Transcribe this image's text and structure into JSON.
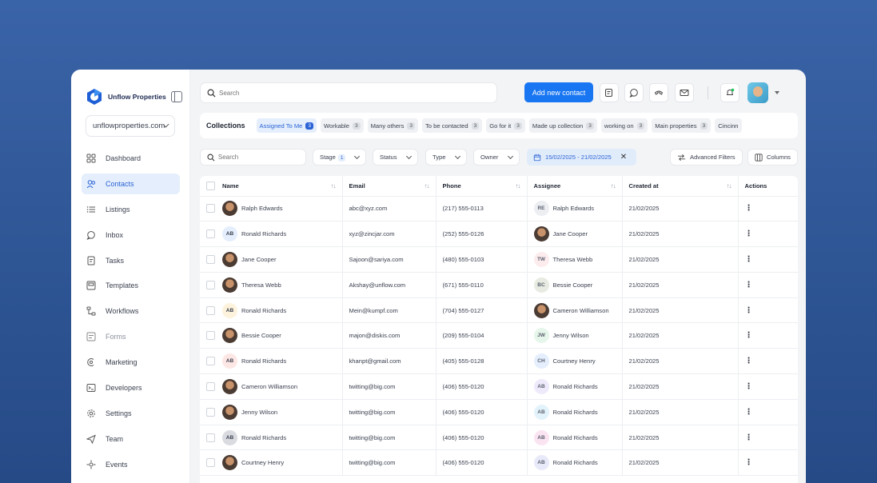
{
  "brand": {
    "name": "Unflow Properties"
  },
  "sidebar": {
    "domain": "unflowproperties.com",
    "items": [
      {
        "label": "Dashboard",
        "icon": "dashboard-icon",
        "active": false,
        "muted": false
      },
      {
        "label": "Contacts",
        "icon": "contacts-icon",
        "active": true,
        "muted": false
      },
      {
        "label": "Listings",
        "icon": "list-icon",
        "active": false,
        "muted": false
      },
      {
        "label": "Inbox",
        "icon": "inbox-icon",
        "active": false,
        "muted": false
      },
      {
        "label": "Tasks",
        "icon": "tasks-icon",
        "active": false,
        "muted": false
      },
      {
        "label": "Templates",
        "icon": "templates-icon",
        "active": false,
        "muted": false
      },
      {
        "label": "Workflows",
        "icon": "workflows-icon",
        "active": false,
        "muted": false
      },
      {
        "label": "Forms",
        "icon": "forms-icon",
        "active": false,
        "muted": true
      },
      {
        "label": "Marketing",
        "icon": "marketing-icon",
        "active": false,
        "muted": false
      },
      {
        "label": "Developers",
        "icon": "terminal-icon",
        "active": false,
        "muted": false
      },
      {
        "label": "Settings",
        "icon": "gear-icon",
        "active": false,
        "muted": false
      },
      {
        "label": "Team",
        "icon": "send-icon",
        "active": false,
        "muted": false
      },
      {
        "label": "Events",
        "icon": "events-icon",
        "active": false,
        "muted": false
      }
    ]
  },
  "topbar": {
    "search_placeholder": "Search",
    "add_button": "Add new contact"
  },
  "collections": {
    "title": "Collections",
    "chips": [
      {
        "label": "Assigned To Me",
        "count": "3",
        "active": true
      },
      {
        "label": "Workable",
        "count": "3",
        "active": false
      },
      {
        "label": "Many others",
        "count": "3",
        "active": false
      },
      {
        "label": "To be contacted",
        "count": "3",
        "active": false
      },
      {
        "label": "Go for it",
        "count": "3",
        "active": false
      },
      {
        "label": "Made up collection",
        "count": "3",
        "active": false
      },
      {
        "label": "working on",
        "count": "3",
        "active": false
      },
      {
        "label": "Main properties",
        "count": "3",
        "active": false
      },
      {
        "label": "Cincinn",
        "count": "",
        "active": false
      }
    ]
  },
  "filters": {
    "search_placeholder": "Search",
    "stage": "Stage",
    "stage_count": "1",
    "status": "Status",
    "type": "Type",
    "owner": "Owner",
    "date_range": "15/02/2025 - 21/02/2025",
    "advanced": "Advanced Filters",
    "columns": "Columns"
  },
  "table": {
    "headers": {
      "name": "Name",
      "email": "Email",
      "phone": "Phone",
      "assignee": "Assignee",
      "created": "Created at",
      "actions": "Actions"
    },
    "rows": [
      {
        "name": "Ralph Edwards",
        "name_initials": "",
        "name_color": "",
        "email": "abc@xyz.com",
        "phone": "(217) 555-0113",
        "assignee": "Ralph Edwards",
        "assignee_initials": "RE",
        "assignee_color": "#eceef2",
        "created": "21/02/2025"
      },
      {
        "name": "Ronald Richards",
        "name_initials": "AB",
        "name_color": "#e4eefc",
        "email": "xyz@zincjar.com",
        "phone": "(252) 555-0126",
        "assignee": "Jane Cooper",
        "assignee_initials": "",
        "assignee_color": "",
        "created": "21/02/2025"
      },
      {
        "name": "Jane Cooper",
        "name_initials": "",
        "name_color": "",
        "email": "Sajoon@sariya.com",
        "phone": "(480) 555-0103",
        "assignee": "Theresa Webb",
        "assignee_initials": "TW",
        "assignee_color": "#fdecee",
        "created": "21/02/2025"
      },
      {
        "name": "Theresa Webb",
        "name_initials": "",
        "name_color": "",
        "email": "Akshay@unflow.com",
        "phone": "(671) 555-0110",
        "assignee": "Bessie Cooper",
        "assignee_initials": "BC",
        "assignee_color": "#e7ebe1",
        "created": "21/02/2025"
      },
      {
        "name": "Ronald Richards",
        "name_initials": "AB",
        "name_color": "#fdf2dc",
        "email": "Mein@kumpf.com",
        "phone": "(704) 555-0127",
        "assignee": "Cameron Williamson",
        "assignee_initials": "",
        "assignee_color": "",
        "created": "21/02/2025"
      },
      {
        "name": "Bessie Cooper",
        "name_initials": "",
        "name_color": "",
        "email": "majon@diskis.com",
        "phone": "(209) 555-0104",
        "assignee": "Jenny Wilson",
        "assignee_initials": "JW",
        "assignee_color": "#e6f6ea",
        "created": "21/02/2025"
      },
      {
        "name": "Ronald Richards",
        "name_initials": "AB",
        "name_color": "#fde7e4",
        "email": "khanpt@gmail.com",
        "phone": "(405) 555-0128",
        "assignee": "Courtney Henry",
        "assignee_initials": "CH",
        "assignee_color": "#e4eefc",
        "created": "21/02/2025"
      },
      {
        "name": "Cameron Williamson",
        "name_initials": "",
        "name_color": "",
        "email": "twitting@big.com",
        "phone": "(406) 555-0120",
        "assignee": "Ronald Richards",
        "assignee_initials": "AB",
        "assignee_color": "#efeafb",
        "created": "21/02/2025"
      },
      {
        "name": "Jenny Wilson",
        "name_initials": "",
        "name_color": "",
        "email": "twitting@big.com",
        "phone": "(406) 555-0120",
        "assignee": "Ronald Richards",
        "assignee_initials": "AB",
        "assignee_color": "#e3f3fb",
        "created": "21/02/2025"
      },
      {
        "name": "Ronald Richards",
        "name_initials": "AB",
        "name_color": "#d9dbe0",
        "email": "twitting@big.com",
        "phone": "(406) 555-0120",
        "assignee": "Ronald Richards",
        "assignee_initials": "AB",
        "assignee_color": "#fbe4f2",
        "created": "21/02/2025"
      },
      {
        "name": "Courtney Henry",
        "name_initials": "",
        "name_color": "",
        "email": "twitting@big.com",
        "phone": "(406) 555-0120",
        "assignee": "Ronald Richards",
        "assignee_initials": "AB",
        "assignee_color": "#e8eaf9",
        "created": "21/02/2025"
      }
    ]
  },
  "colors": {
    "accent": "#1976f2",
    "active_bg": "#e4eefc",
    "background": "#3a64a8"
  }
}
